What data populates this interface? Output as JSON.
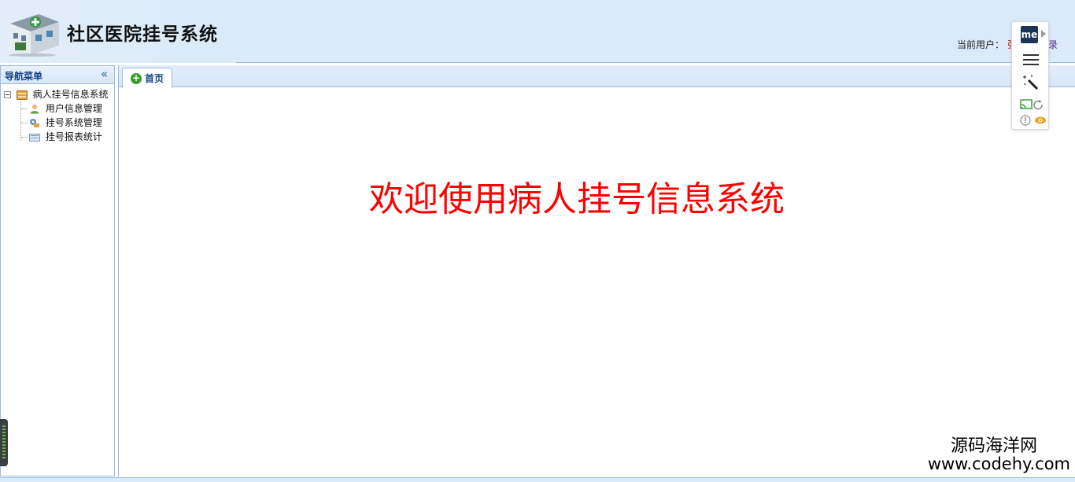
{
  "header": {
    "title": "社区医院挂号系统",
    "current_user_label": "当前用户：",
    "user_name": "张",
    "logout_text": "录"
  },
  "sidebar": {
    "title": "导航菜单",
    "collapse_icon": "double-chevron-left-icon",
    "tree": {
      "root": {
        "label": "病人挂号信息系统",
        "icon": "folder-icon"
      },
      "children": [
        {
          "label": "用户信息管理",
          "icon": "user-icon"
        },
        {
          "label": "挂号系统管理",
          "icon": "gear-icon"
        },
        {
          "label": "挂号报表统计",
          "icon": "report-icon"
        }
      ]
    }
  },
  "tabs": [
    {
      "label": "首页",
      "icon": "plus-circle-icon",
      "active": true
    }
  ],
  "content": {
    "welcome": "欢迎使用病人挂号信息系统"
  },
  "watermark": {
    "cn": "源码海洋网",
    "url": "www.codehy.com"
  },
  "extension": {
    "logo_text": "me"
  },
  "colors": {
    "header_bg": "#daeaf8",
    "border": "#99bbe8",
    "welcome_text": "#ff0000",
    "title_blue": "#15428b"
  }
}
